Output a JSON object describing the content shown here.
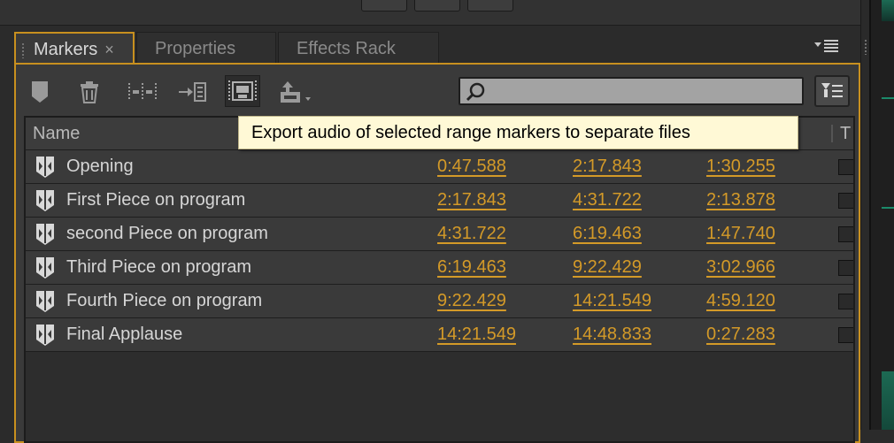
{
  "tabs": [
    {
      "label": "Markers",
      "close": "×"
    },
    {
      "label": "Properties"
    },
    {
      "label": "Effects Rack"
    }
  ],
  "panel_menu_icon": "panel-menu-icon",
  "toolbar": {
    "icons": [
      "marker-add-icon",
      "trash-icon",
      "merge-markers-icon",
      "insert-into-playlist-icon",
      "export-range-icon",
      "batch-export-icon"
    ],
    "search_placeholder": "",
    "filter_icon": "filter-list-icon"
  },
  "table": {
    "header_name": "Name",
    "header_t": "T",
    "rows": [
      {
        "name": "Opening",
        "start": "0:47.588",
        "end": "2:17.843",
        "duration": "1:30.255"
      },
      {
        "name": "First Piece on program",
        "start": "2:17.843",
        "end": "4:31.722",
        "duration": "2:13.878"
      },
      {
        "name": "second Piece on program",
        "start": "4:31.722",
        "end": "6:19.463",
        "duration": "1:47.740"
      },
      {
        "name": "Third Piece on program",
        "start": "6:19.463",
        "end": "9:22.429",
        "duration": "3:02.966"
      },
      {
        "name": "Fourth Piece on program",
        "start": "9:22.429",
        "end": "14:21.549",
        "duration": "4:59.120"
      },
      {
        "name": "Final Applause",
        "start": "14:21.549",
        "end": "14:48.833",
        "duration": "0:27.283"
      }
    ]
  },
  "tooltip": "Export audio of selected range markers to separate files",
  "colors": {
    "accent": "#c8901f",
    "timecode": "#d49a28",
    "tooltip_bg": "#fff9d6"
  }
}
